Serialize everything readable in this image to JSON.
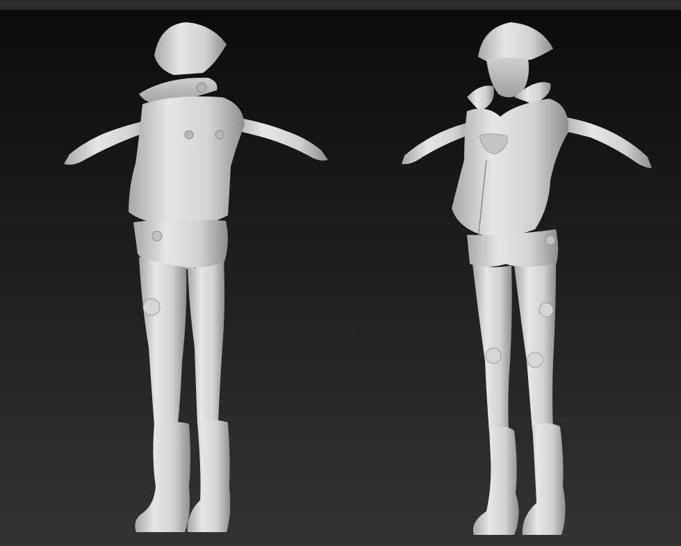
{
  "scene": {
    "description_type": "3d-sculpt-render",
    "background_top": "#0b0b0b",
    "background_bottom": "#333333",
    "material_color": "#d8d8d8",
    "shadow_color": "#9a9a9a"
  },
  "figures": [
    {
      "view": "back",
      "icon": "sculpt-figure-back-view"
    },
    {
      "view": "front",
      "icon": "sculpt-figure-front-view"
    }
  ]
}
